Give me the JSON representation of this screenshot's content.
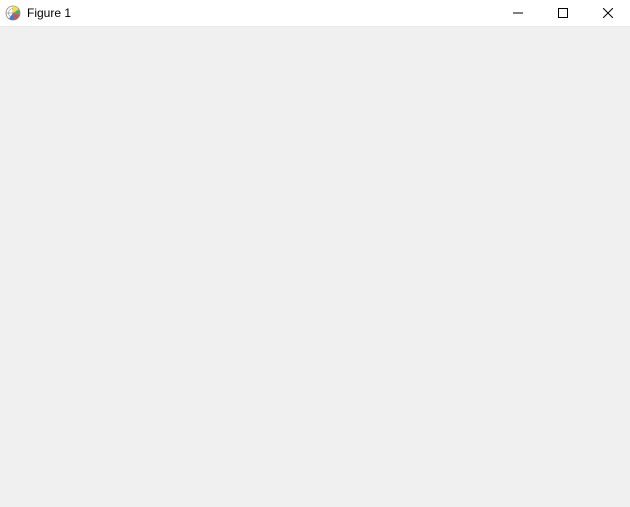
{
  "window": {
    "title": "Figure 1"
  }
}
